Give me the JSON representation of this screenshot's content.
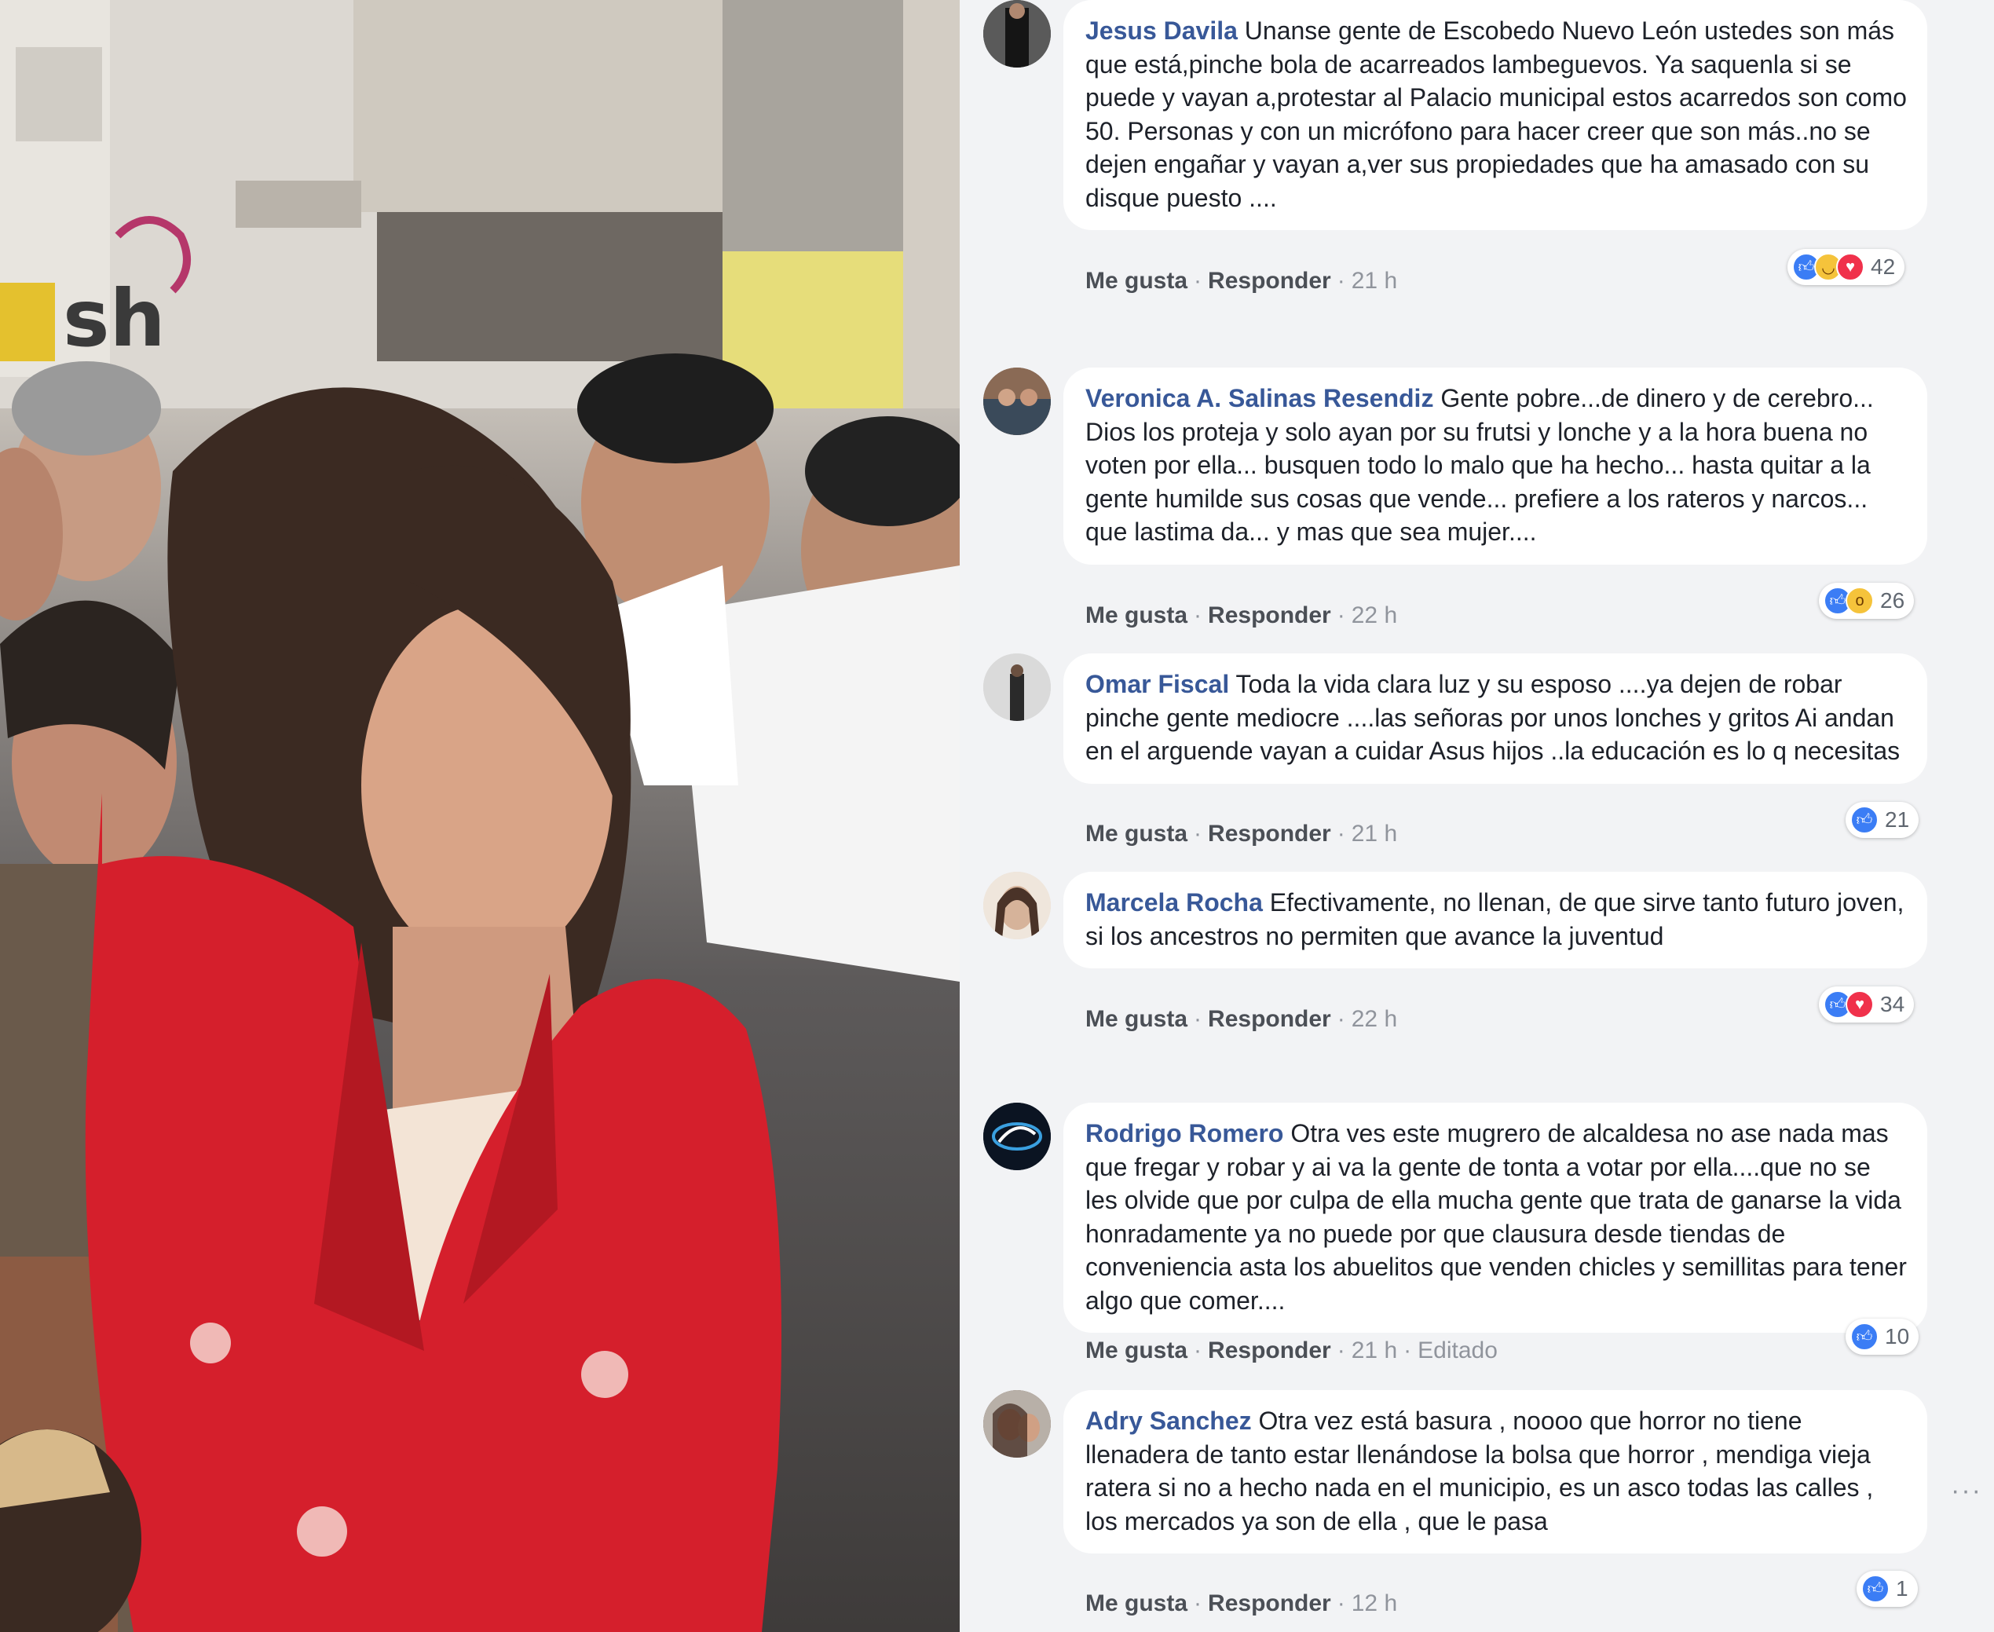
{
  "photo": {
    "graffiti_text": "sh"
  },
  "comments": [
    {
      "author": "Jesus Davila",
      "text": "Unanse gente de Escobedo Nuevo León ustedes son más que está,pinche bola de acarreados lambeguevos. Ya saquenla si se puede y vayan a,protestar al Palacio municipal estos acarredos son como 50. Personas y con un micrófono para hacer creer que son más..no se dejen engañar y vayan a,ver sus propiedades que ha amasado con su disque puesto ....",
      "like": "Me gusta",
      "reply": "Responder",
      "time": "21 h",
      "edited": "",
      "reactions": [
        "like",
        "haha",
        "love"
      ],
      "count": "42"
    },
    {
      "author": "Veronica A. Salinas Resendiz",
      "text": "Gente pobre...de dinero y de cerebro... Dios los proteja y solo ayan por su frutsi y lonche y a la hora buena no voten por ella... busquen todo lo malo que ha hecho... hasta quitar a la gente humilde sus cosas que vende... prefiere a los rateros y narcos... que lastima da... y mas que sea mujer....",
      "like": "Me gusta",
      "reply": "Responder",
      "time": "22 h",
      "edited": "",
      "reactions": [
        "like",
        "wow"
      ],
      "count": "26"
    },
    {
      "author": "Omar Fiscal",
      "text": "Toda la vida clara luz y su esposo ....ya dejen de robar pinche gente mediocre ....las señoras por unos lonches y gritos Ai andan en el arguende vayan a cuidar Asus hijos ..la educación es lo q necesitas",
      "like": "Me gusta",
      "reply": "Responder",
      "time": "21 h",
      "edited": "",
      "reactions": [
        "like"
      ],
      "count": "21"
    },
    {
      "author": "Marcela Rocha",
      "text": "Efectivamente, no llenan, de que sirve tanto futuro joven, si los ancestros no permiten que avance la juventud",
      "like": "Me gusta",
      "reply": "Responder",
      "time": "22 h",
      "edited": "",
      "reactions": [
        "like",
        "love"
      ],
      "count": "34"
    },
    {
      "author": "Rodrigo Romero",
      "text": "Otra ves este mugrero de alcaldesa no ase nada mas que fregar y robar y ai va la gente de tonta a votar por ella....que no se les olvide que por culpa de ella mucha gente que trata de ganarse la vida honradamente ya no puede por que clausura desde tiendas de conveniencia asta los abuelitos que venden chicles y semillitas para tener algo que comer....",
      "like": "Me gusta",
      "reply": "Responder",
      "time": "21 h",
      "edited": "Editado",
      "reactions": [
        "like"
      ],
      "count": "10"
    },
    {
      "author": "Adry Sanchez",
      "text": "Otra vez está basura , noooo que horror no tiene llenadera de tanto estar llenándose la bolsa que horror , mendiga vieja ratera si no a hecho nada en el municipio, es un asco todas las calles , los mercados ya son de ella , que le pasa",
      "like": "Me gusta",
      "reply": "Responder",
      "time": "12 h",
      "edited": "",
      "reactions": [
        "like"
      ],
      "count": "1"
    }
  ],
  "colors": {
    "author": "#385898",
    "panel_bg": "#f2f3f5",
    "like_blue": "#3b7df5",
    "love_red": "#f0314b",
    "haha_yellow": "#f5c33b"
  }
}
